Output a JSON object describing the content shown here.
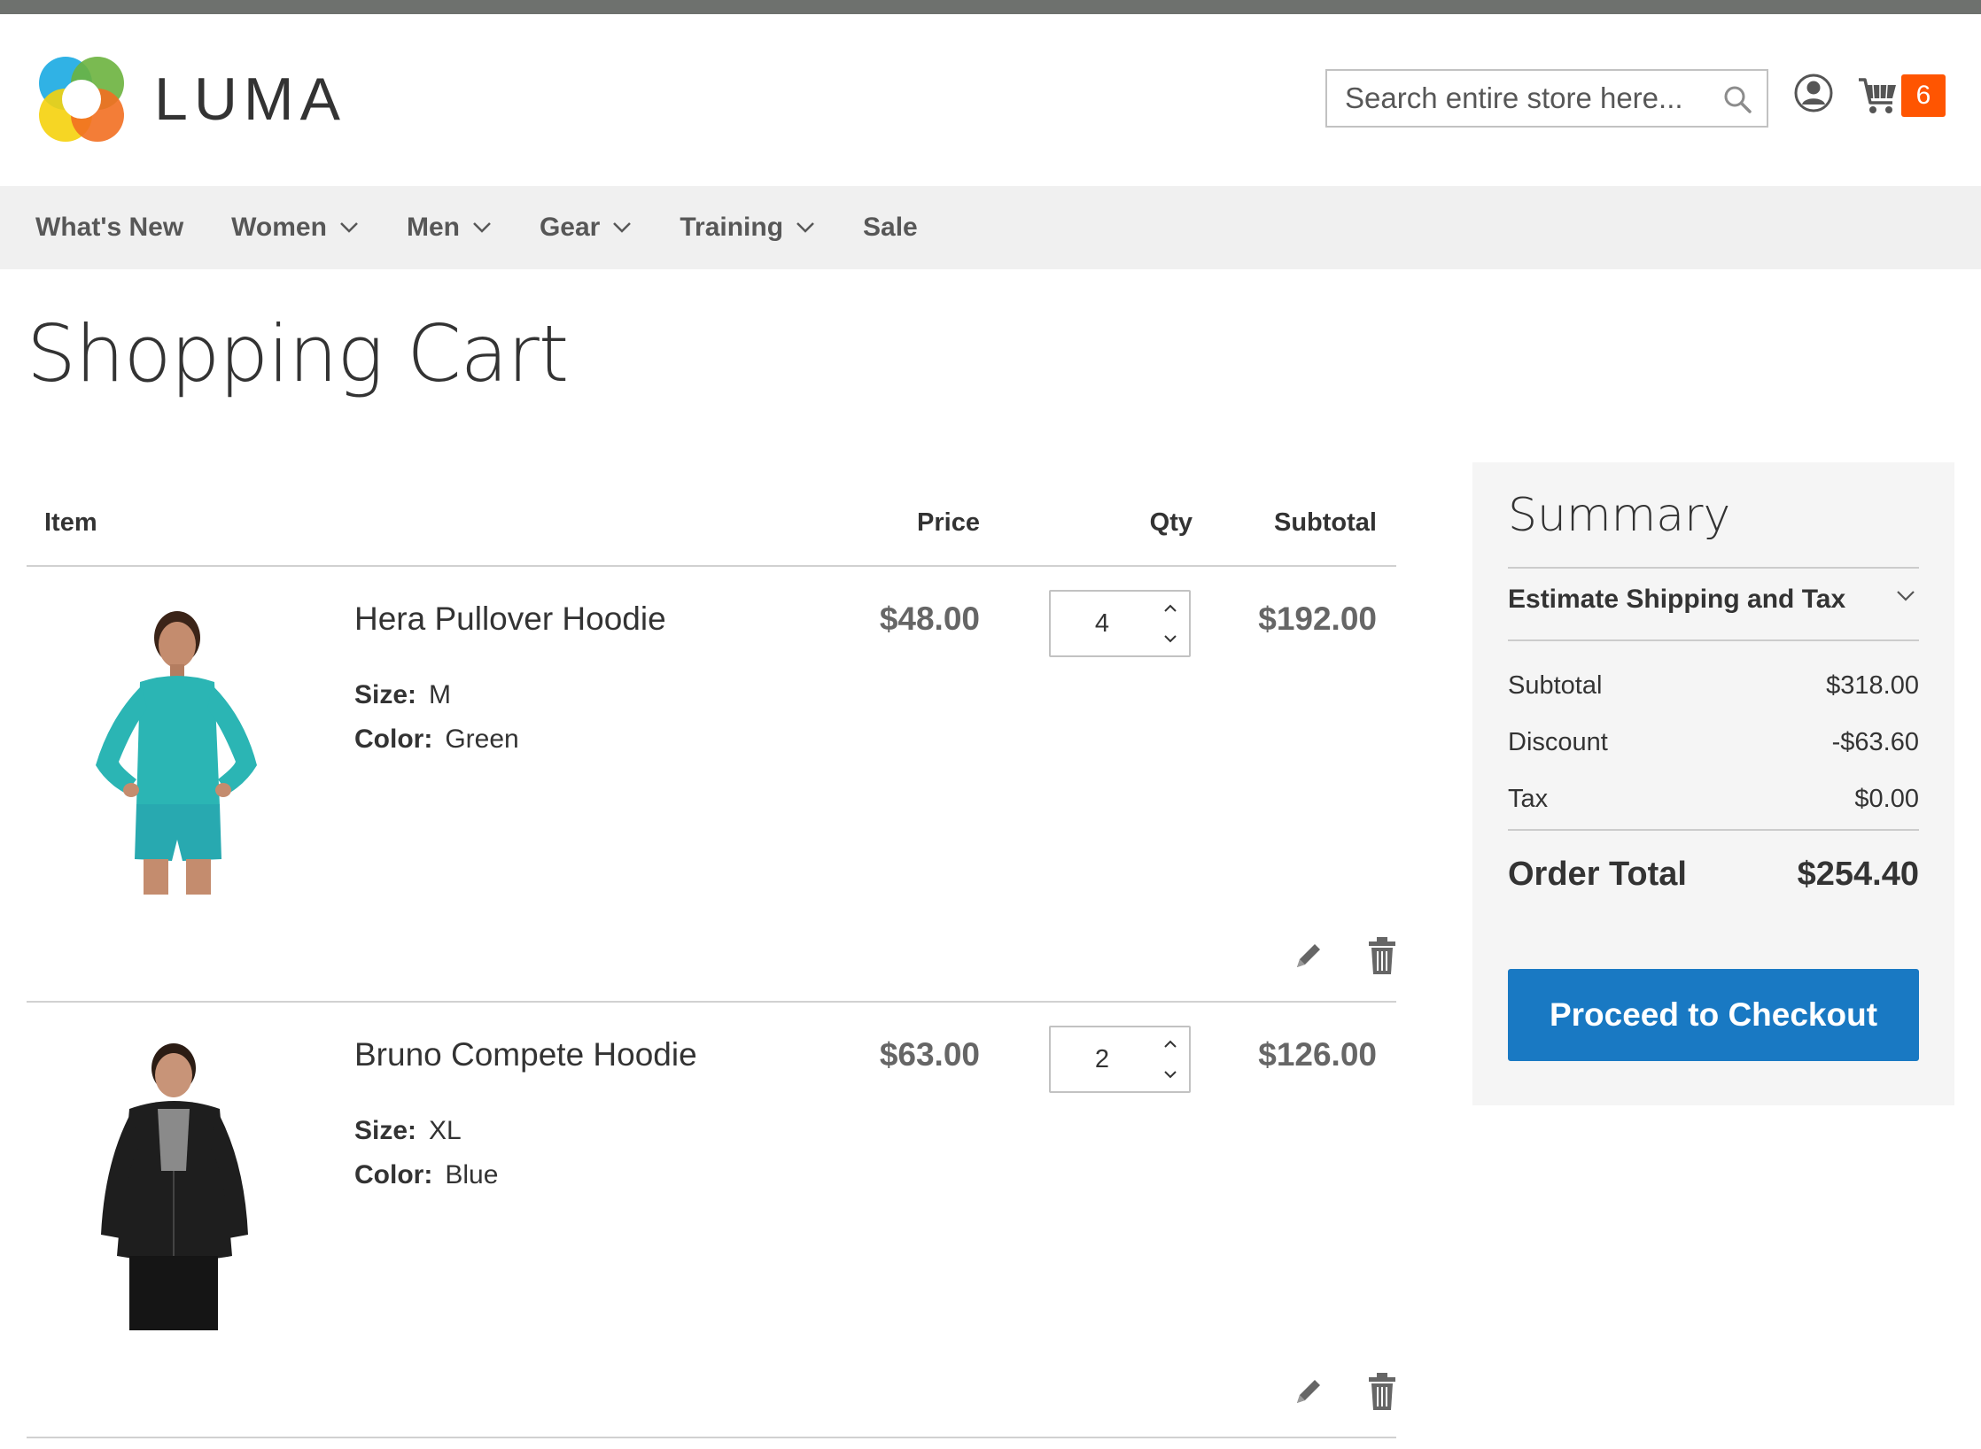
{
  "header": {
    "logo_text": "LUMA",
    "search_placeholder": "Search entire store here...",
    "cart_count": "6"
  },
  "nav": {
    "items": [
      {
        "label": "What's New",
        "has_dropdown": false
      },
      {
        "label": "Women",
        "has_dropdown": true
      },
      {
        "label": "Men",
        "has_dropdown": true
      },
      {
        "label": "Gear",
        "has_dropdown": true
      },
      {
        "label": "Training",
        "has_dropdown": true
      },
      {
        "label": "Sale",
        "has_dropdown": false
      }
    ]
  },
  "page": {
    "title": "Shopping Cart"
  },
  "cart": {
    "columns": {
      "item": "Item",
      "price": "Price",
      "qty": "Qty",
      "subtotal": "Subtotal"
    },
    "items": [
      {
        "name": "Hera Pullover Hoodie",
        "size_label": "Size:",
        "size": "M",
        "color_label": "Color:",
        "color": "Green",
        "price": "$48.00",
        "qty": "4",
        "subtotal": "$192.00",
        "photo_icon": "product-photo-woman-teal-hoodie"
      },
      {
        "name": "Bruno Compete Hoodie",
        "size_label": "Size:",
        "size": "XL",
        "color_label": "Color:",
        "color": "Blue",
        "price": "$63.00",
        "qty": "2",
        "subtotal": "$126.00",
        "photo_icon": "product-photo-man-black-hoodie"
      }
    ]
  },
  "summary": {
    "title": "Summary",
    "estimate_label": "Estimate Shipping and Tax",
    "subtotal_label": "Subtotal",
    "subtotal": "$318.00",
    "discount_label": "Discount",
    "discount": "-$63.60",
    "tax_label": "Tax",
    "tax": "$0.00",
    "order_total_label": "Order Total",
    "order_total": "$254.40",
    "checkout_label": "Proceed to Checkout"
  },
  "colors": {
    "accent": "#1979c3",
    "cart_badge": "#ff5501",
    "nav_bg": "#f0f0f0",
    "summary_bg": "#f5f5f5"
  }
}
